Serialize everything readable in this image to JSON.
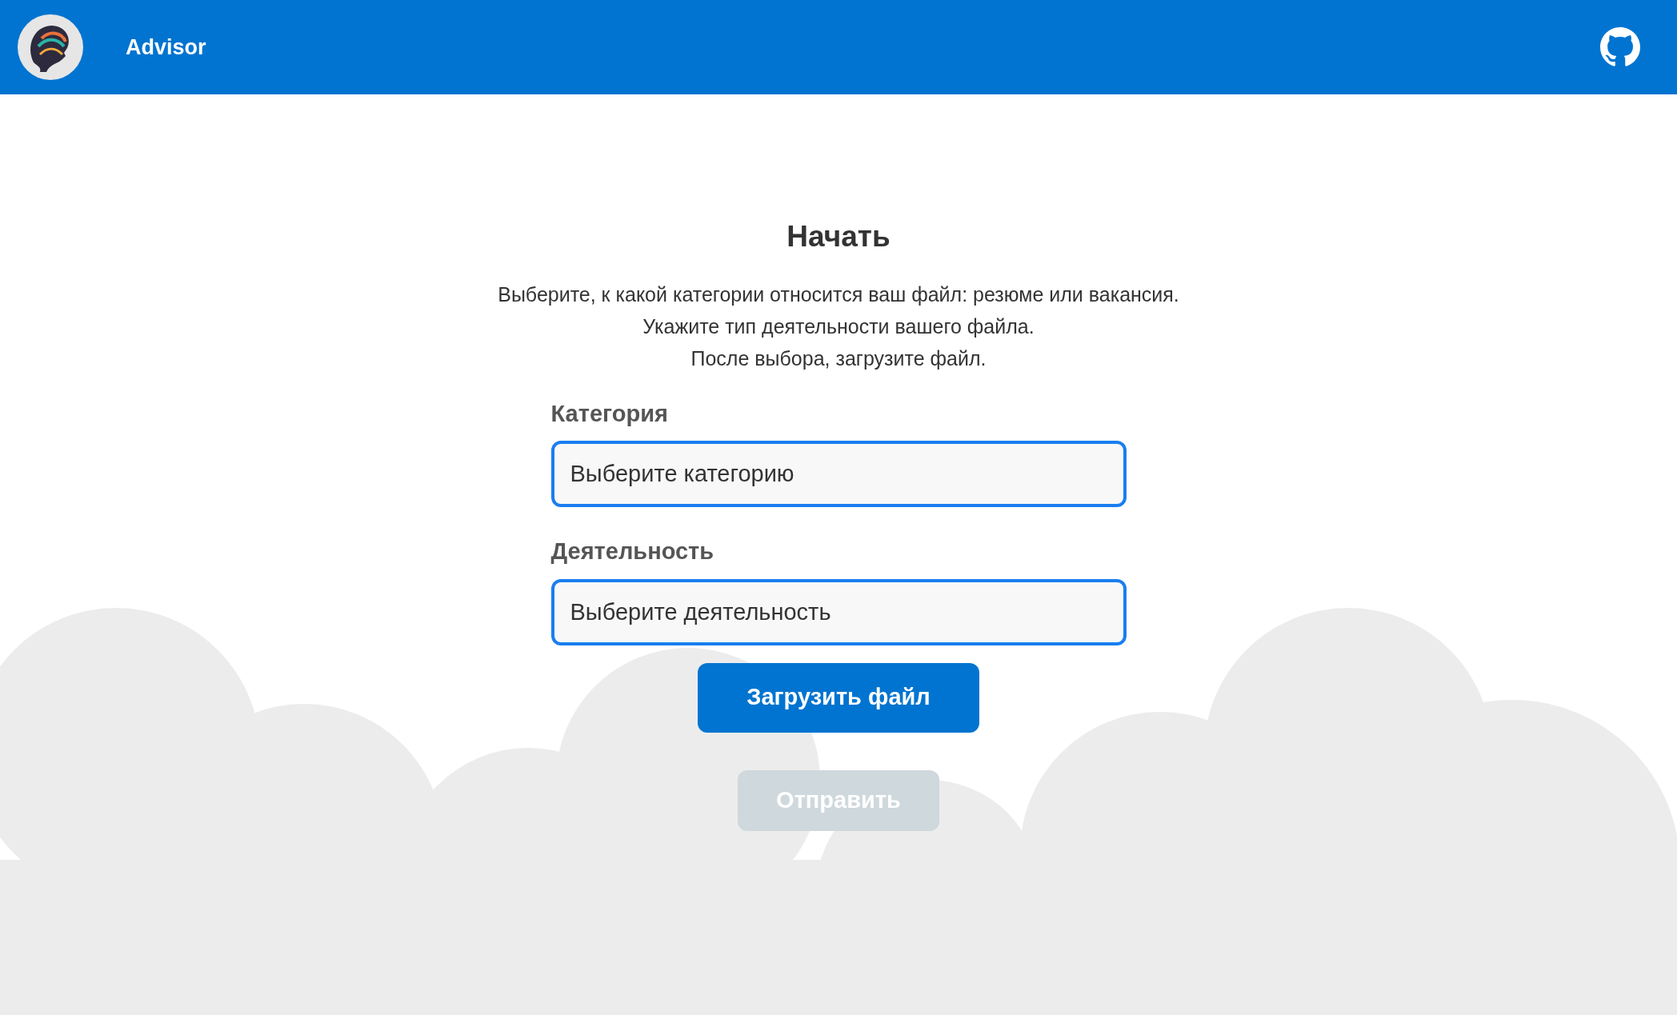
{
  "header": {
    "title": "Advisor"
  },
  "main": {
    "title": "Начать",
    "description": [
      "Выберите, к какой категории относится ваш файл: резюме или вакансия.",
      "Укажите тип деятельности вашего файла.",
      "После выбора, загрузите файл."
    ],
    "fields": [
      {
        "label": "Категория",
        "placeholder": "Выберите категорию"
      },
      {
        "label": "Деятельность",
        "placeholder": "Выберите деятельность"
      }
    ],
    "buttons": [
      {
        "label": "Загрузить файл",
        "kind": "primary",
        "disabled": false
      },
      {
        "label": "Отправить",
        "kind": "submit",
        "disabled": true
      }
    ]
  }
}
